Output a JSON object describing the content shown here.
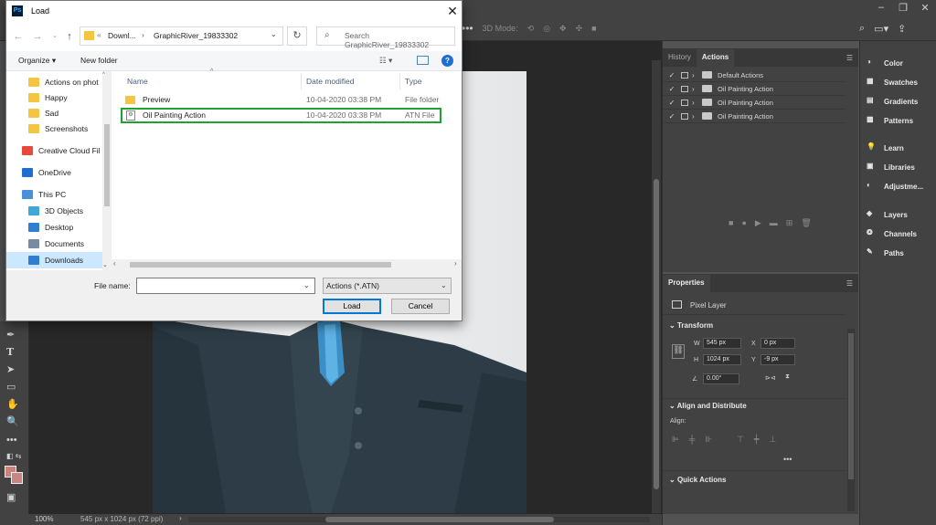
{
  "photoshop": {
    "options_bar": {
      "mode_label": "3D Mode:"
    },
    "status_bar": {
      "zoom": "100%",
      "doc_info": "545 px x 1024 px (72 ppi)"
    }
  },
  "actions_panel": {
    "tabs": [
      {
        "label": "History"
      },
      {
        "label": "Actions"
      }
    ],
    "items": [
      {
        "label": "Default Actions"
      },
      {
        "label": "Oil Painting Action"
      },
      {
        "label": "Oil Painting Action"
      },
      {
        "label": "Oil Painting Action"
      }
    ]
  },
  "properties_panel": {
    "tab": "Properties",
    "layer_type": "Pixel Layer",
    "transform": {
      "heading": "Transform",
      "w_label": "W",
      "w": "545 px",
      "h_label": "H",
      "h": "1024 px",
      "x_label": "X",
      "x": "0 px",
      "y_label": "Y",
      "y": "-9 px",
      "angle": "0.00°"
    },
    "align": {
      "heading": "Align and Distribute",
      "sub": "Align:"
    },
    "quick_actions": {
      "heading": "Quick Actions"
    }
  },
  "right_column": {
    "group1": [
      {
        "label": "Color",
        "icon": "color-icon"
      },
      {
        "label": "Swatches",
        "icon": "swatches-icon"
      },
      {
        "label": "Gradients",
        "icon": "gradients-icon"
      },
      {
        "label": "Patterns",
        "icon": "patterns-icon"
      }
    ],
    "group2": [
      {
        "label": "Learn",
        "icon": "lightbulb-icon"
      },
      {
        "label": "Libraries",
        "icon": "libraries-icon"
      },
      {
        "label": "Adjustme...",
        "icon": "adjustments-icon"
      }
    ],
    "group3": [
      {
        "label": "Layers",
        "icon": "layers-icon"
      },
      {
        "label": "Channels",
        "icon": "channels-icon"
      },
      {
        "label": "Paths",
        "icon": "paths-icon"
      }
    ]
  },
  "dialog": {
    "title": "Load",
    "app_icon_text": "Ps",
    "address": {
      "prefix": "«",
      "crumb1": "Downl...",
      "crumb2": "GraphicRiver_19833302"
    },
    "search_placeholder": "Search GraphicRiver_19833302",
    "toolbar": {
      "organize": "Organize ▾",
      "new_folder": "New folder"
    },
    "nav_items": [
      {
        "label": "Actions on phot",
        "type": "folder"
      },
      {
        "label": "Happy",
        "type": "folder"
      },
      {
        "label": "Sad",
        "type": "folder"
      },
      {
        "label": "Screenshots",
        "type": "folder"
      },
      {
        "label": "Creative Cloud Fil",
        "type": "cloud"
      },
      {
        "label": "OneDrive",
        "type": "onedrive"
      },
      {
        "label": "This PC",
        "type": "pc"
      },
      {
        "label": "3D Objects",
        "type": "3d"
      },
      {
        "label": "Desktop",
        "type": "desktop"
      },
      {
        "label": "Documents",
        "type": "documents"
      },
      {
        "label": "Downloads",
        "type": "downloads"
      }
    ],
    "columns": {
      "name": "Name",
      "date": "Date modified",
      "type": "Type"
    },
    "files": [
      {
        "name": "Preview",
        "date": "10-04-2020 03:38 PM",
        "type": "File folder"
      },
      {
        "name": "Oil Painting Action",
        "date": "10-04-2020 03:38 PM",
        "type": "ATN File"
      }
    ],
    "file_name_label": "File name:",
    "file_name_value": "",
    "file_type": "Actions (*.ATN)",
    "load_label": "Load",
    "cancel_label": "Cancel"
  }
}
